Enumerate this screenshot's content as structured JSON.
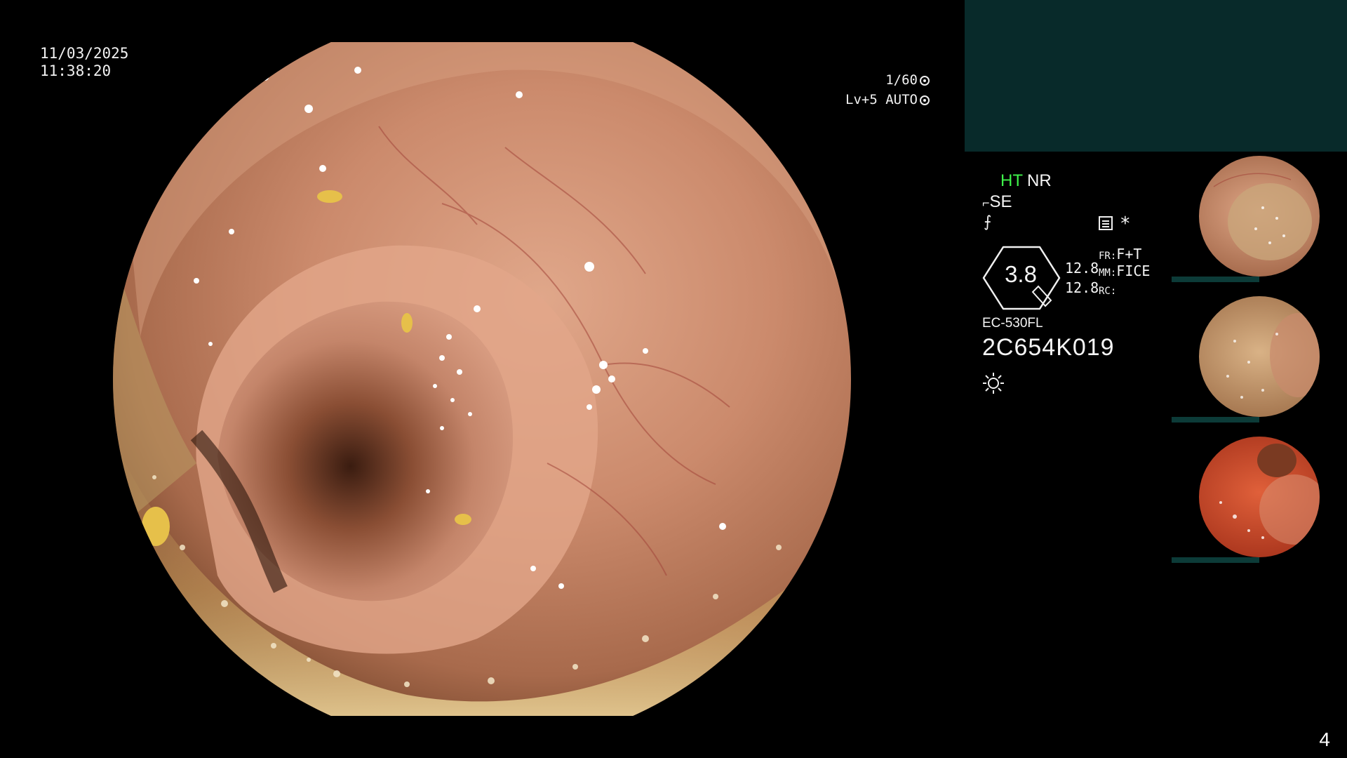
{
  "datetime": {
    "date": "11/03/2025",
    "time": "11:38:20"
  },
  "exposure": {
    "shutter": "1/60",
    "level": "Lv+5 AUTO"
  },
  "info_panel": {
    "ht_label": "HT",
    "nr_label": "NR",
    "se_label": "SE",
    "zoom_value": "3.8",
    "value_top": "12.8",
    "value_bottom": "12.8",
    "fr_label": "FR:",
    "fr_value": "F+T",
    "mm_label": "MM:",
    "mm_value": "FICE",
    "rc_label": "RC:",
    "scope_model": "EC-530FL",
    "scope_serial": "2C654K019",
    "icons": [
      "hose-icon",
      "flash-icon",
      "memo-icon",
      "asterisk-icon",
      "light-icon"
    ]
  },
  "thumbnails": [
    {
      "name": "thumbnail-1",
      "tint": "#c7855e"
    },
    {
      "name": "thumbnail-2",
      "tint": "#c59a6e"
    },
    {
      "name": "thumbnail-3",
      "tint": "#d04a2a"
    }
  ],
  "colors": {
    "background": "#000000",
    "teal_panel": "#082a2a",
    "ht_green": "#3ef24a",
    "mucosa": "#c98a6c",
    "debris_yellow": "#d8b260"
  },
  "page_number": "4"
}
